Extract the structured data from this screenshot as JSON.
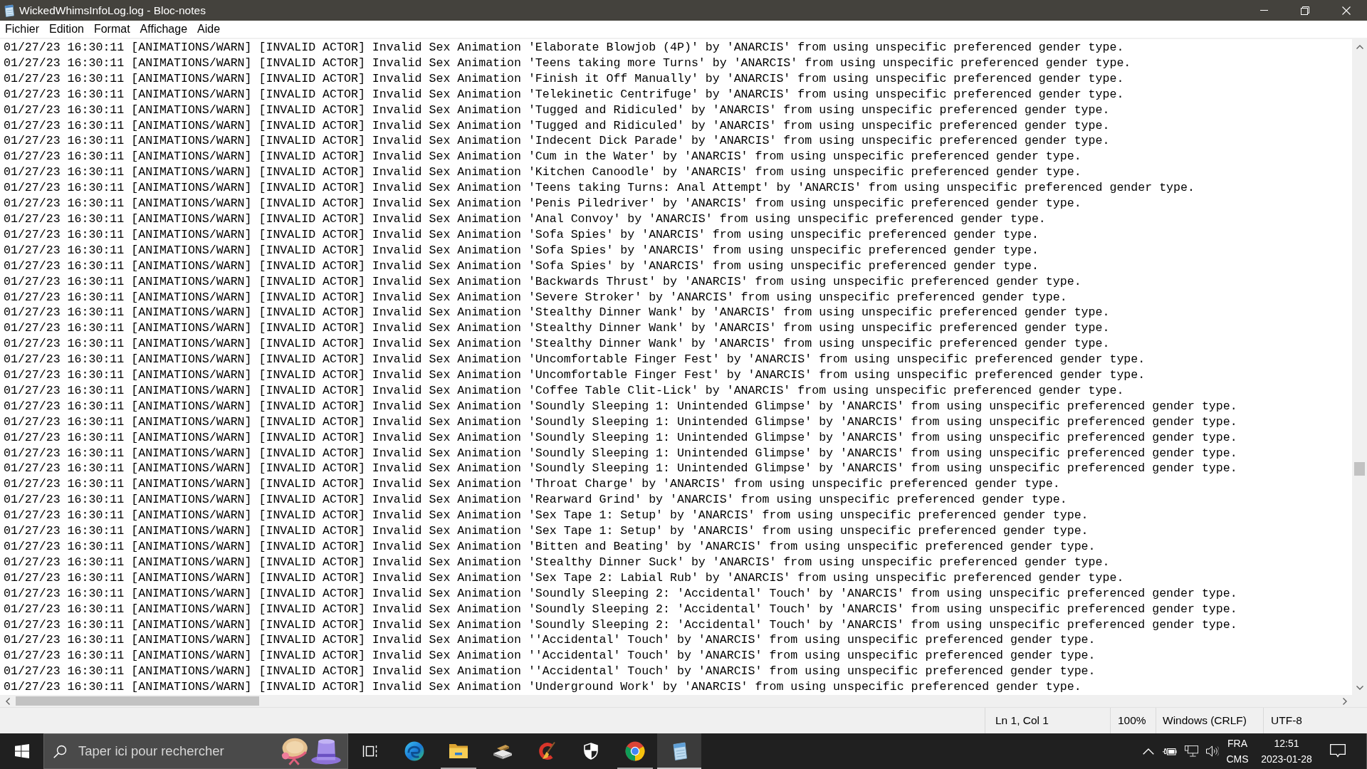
{
  "window": {
    "title": "WickedWhimsInfoLog.log - Bloc-notes"
  },
  "menu": [
    "Fichier",
    "Edition",
    "Format",
    "Affichage",
    "Aide"
  ],
  "editor": {
    "lines": [
      "01/27/23 16:30:11 [ANIMATIONS/WARN] [INVALID ACTOR] Invalid Sex Animation 'Elaborate Blowjob (4P)' by 'ANARCIS' from using unspecific preferenced gender type.",
      "01/27/23 16:30:11 [ANIMATIONS/WARN] [INVALID ACTOR] Invalid Sex Animation 'Teens taking more Turns' by 'ANARCIS' from using unspecific preferenced gender type.",
      "01/27/23 16:30:11 [ANIMATIONS/WARN] [INVALID ACTOR] Invalid Sex Animation 'Finish it Off Manually' by 'ANARCIS' from using unspecific preferenced gender type.",
      "01/27/23 16:30:11 [ANIMATIONS/WARN] [INVALID ACTOR] Invalid Sex Animation 'Telekinetic Centrifuge' by 'ANARCIS' from using unspecific preferenced gender type.",
      "01/27/23 16:30:11 [ANIMATIONS/WARN] [INVALID ACTOR] Invalid Sex Animation 'Tugged and Ridiculed' by 'ANARCIS' from using unspecific preferenced gender type.",
      "01/27/23 16:30:11 [ANIMATIONS/WARN] [INVALID ACTOR] Invalid Sex Animation 'Tugged and Ridiculed' by 'ANARCIS' from using unspecific preferenced gender type.",
      "01/27/23 16:30:11 [ANIMATIONS/WARN] [INVALID ACTOR] Invalid Sex Animation 'Indecent Dick Parade' by 'ANARCIS' from using unspecific preferenced gender type.",
      "01/27/23 16:30:11 [ANIMATIONS/WARN] [INVALID ACTOR] Invalid Sex Animation 'Cum in the Water' by 'ANARCIS' from using unspecific preferenced gender type.",
      "01/27/23 16:30:11 [ANIMATIONS/WARN] [INVALID ACTOR] Invalid Sex Animation 'Kitchen Canoodle' by 'ANARCIS' from using unspecific preferenced gender type.",
      "01/27/23 16:30:11 [ANIMATIONS/WARN] [INVALID ACTOR] Invalid Sex Animation 'Teens taking Turns: Anal Attempt' by 'ANARCIS' from using unspecific preferenced gender type.",
      "01/27/23 16:30:11 [ANIMATIONS/WARN] [INVALID ACTOR] Invalid Sex Animation 'Penis Piledriver' by 'ANARCIS' from using unspecific preferenced gender type.",
      "01/27/23 16:30:11 [ANIMATIONS/WARN] [INVALID ACTOR] Invalid Sex Animation 'Anal Convoy' by 'ANARCIS' from using unspecific preferenced gender type.",
      "01/27/23 16:30:11 [ANIMATIONS/WARN] [INVALID ACTOR] Invalid Sex Animation 'Sofa Spies' by 'ANARCIS' from using unspecific preferenced gender type.",
      "01/27/23 16:30:11 [ANIMATIONS/WARN] [INVALID ACTOR] Invalid Sex Animation 'Sofa Spies' by 'ANARCIS' from using unspecific preferenced gender type.",
      "01/27/23 16:30:11 [ANIMATIONS/WARN] [INVALID ACTOR] Invalid Sex Animation 'Sofa Spies' by 'ANARCIS' from using unspecific preferenced gender type.",
      "01/27/23 16:30:11 [ANIMATIONS/WARN] [INVALID ACTOR] Invalid Sex Animation 'Backwards Thrust' by 'ANARCIS' from using unspecific preferenced gender type.",
      "01/27/23 16:30:11 [ANIMATIONS/WARN] [INVALID ACTOR] Invalid Sex Animation 'Severe Stroker' by 'ANARCIS' from using unspecific preferenced gender type.",
      "01/27/23 16:30:11 [ANIMATIONS/WARN] [INVALID ACTOR] Invalid Sex Animation 'Stealthy Dinner Wank' by 'ANARCIS' from using unspecific preferenced gender type.",
      "01/27/23 16:30:11 [ANIMATIONS/WARN] [INVALID ACTOR] Invalid Sex Animation 'Stealthy Dinner Wank' by 'ANARCIS' from using unspecific preferenced gender type.",
      "01/27/23 16:30:11 [ANIMATIONS/WARN] [INVALID ACTOR] Invalid Sex Animation 'Stealthy Dinner Wank' by 'ANARCIS' from using unspecific preferenced gender type.",
      "01/27/23 16:30:11 [ANIMATIONS/WARN] [INVALID ACTOR] Invalid Sex Animation 'Uncomfortable Finger Fest' by 'ANARCIS' from using unspecific preferenced gender type.",
      "01/27/23 16:30:11 [ANIMATIONS/WARN] [INVALID ACTOR] Invalid Sex Animation 'Uncomfortable Finger Fest' by 'ANARCIS' from using unspecific preferenced gender type.",
      "01/27/23 16:30:11 [ANIMATIONS/WARN] [INVALID ACTOR] Invalid Sex Animation 'Coffee Table Clit-Lick' by 'ANARCIS' from using unspecific preferenced gender type.",
      "01/27/23 16:30:11 [ANIMATIONS/WARN] [INVALID ACTOR] Invalid Sex Animation 'Soundly Sleeping 1: Unintended Glimpse' by 'ANARCIS' from using unspecific preferenced gender type.",
      "01/27/23 16:30:11 [ANIMATIONS/WARN] [INVALID ACTOR] Invalid Sex Animation 'Soundly Sleeping 1: Unintended Glimpse' by 'ANARCIS' from using unspecific preferenced gender type.",
      "01/27/23 16:30:11 [ANIMATIONS/WARN] [INVALID ACTOR] Invalid Sex Animation 'Soundly Sleeping 1: Unintended Glimpse' by 'ANARCIS' from using unspecific preferenced gender type.",
      "01/27/23 16:30:11 [ANIMATIONS/WARN] [INVALID ACTOR] Invalid Sex Animation 'Soundly Sleeping 1: Unintended Glimpse' by 'ANARCIS' from using unspecific preferenced gender type.",
      "01/27/23 16:30:11 [ANIMATIONS/WARN] [INVALID ACTOR] Invalid Sex Animation 'Soundly Sleeping 1: Unintended Glimpse' by 'ANARCIS' from using unspecific preferenced gender type.",
      "01/27/23 16:30:11 [ANIMATIONS/WARN] [INVALID ACTOR] Invalid Sex Animation 'Throat Charge' by 'ANARCIS' from using unspecific preferenced gender type.",
      "01/27/23 16:30:11 [ANIMATIONS/WARN] [INVALID ACTOR] Invalid Sex Animation 'Rearward Grind' by 'ANARCIS' from using unspecific preferenced gender type.",
      "01/27/23 16:30:11 [ANIMATIONS/WARN] [INVALID ACTOR] Invalid Sex Animation 'Sex Tape 1: Setup' by 'ANARCIS' from using unspecific preferenced gender type.",
      "01/27/23 16:30:11 [ANIMATIONS/WARN] [INVALID ACTOR] Invalid Sex Animation 'Sex Tape 1: Setup' by 'ANARCIS' from using unspecific preferenced gender type.",
      "01/27/23 16:30:11 [ANIMATIONS/WARN] [INVALID ACTOR] Invalid Sex Animation 'Bitten and Beating' by 'ANARCIS' from using unspecific preferenced gender type.",
      "01/27/23 16:30:11 [ANIMATIONS/WARN] [INVALID ACTOR] Invalid Sex Animation 'Stealthy Dinner Suck' by 'ANARCIS' from using unspecific preferenced gender type.",
      "01/27/23 16:30:11 [ANIMATIONS/WARN] [INVALID ACTOR] Invalid Sex Animation 'Sex Tape 2: Labial Rub' by 'ANARCIS' from using unspecific preferenced gender type.",
      "01/27/23 16:30:11 [ANIMATIONS/WARN] [INVALID ACTOR] Invalid Sex Animation 'Soundly Sleeping 2: 'Accidental' Touch' by 'ANARCIS' from using unspecific preferenced gender type.",
      "01/27/23 16:30:11 [ANIMATIONS/WARN] [INVALID ACTOR] Invalid Sex Animation 'Soundly Sleeping 2: 'Accidental' Touch' by 'ANARCIS' from using unspecific preferenced gender type.",
      "01/27/23 16:30:11 [ANIMATIONS/WARN] [INVALID ACTOR] Invalid Sex Animation 'Soundly Sleeping 2: 'Accidental' Touch' by 'ANARCIS' from using unspecific preferenced gender type.",
      "01/27/23 16:30:11 [ANIMATIONS/WARN] [INVALID ACTOR] Invalid Sex Animation ''Accidental' Touch' by 'ANARCIS' from using unspecific preferenced gender type.",
      "01/27/23 16:30:11 [ANIMATIONS/WARN] [INVALID ACTOR] Invalid Sex Animation ''Accidental' Touch' by 'ANARCIS' from using unspecific preferenced gender type.",
      "01/27/23 16:30:11 [ANIMATIONS/WARN] [INVALID ACTOR] Invalid Sex Animation ''Accidental' Touch' by 'ANARCIS' from using unspecific preferenced gender type.",
      "01/27/23 16:30:11 [ANIMATIONS/WARN] [INVALID ACTOR] Invalid Sex Animation 'Underground Work' by 'ANARCIS' from using unspecific preferenced gender type."
    ]
  },
  "status_bar": {
    "position": "Ln 1, Col 1",
    "zoom": "100%",
    "line_ending": "Windows (CRLF)",
    "encoding": "UTF-8"
  },
  "taskbar": {
    "search": {
      "placeholder": "Taper ici pour rechercher"
    },
    "apps": [
      {
        "kind": "swirl",
        "running": false,
        "selected": false
      },
      {
        "kind": "folder",
        "running": true,
        "selected": false
      },
      {
        "kind": "scanner",
        "running": false,
        "selected": false
      },
      {
        "kind": "brush",
        "running": false,
        "selected": false
      },
      {
        "kind": "shield",
        "running": false,
        "selected": false
      },
      {
        "kind": "wheel",
        "running": true,
        "selected": false
      },
      {
        "kind": "notepad",
        "running": true,
        "selected": true
      }
    ],
    "tray": {
      "language": "FRA",
      "layout": "CMS",
      "time": "12:51",
      "date": "2023-01-28"
    }
  }
}
